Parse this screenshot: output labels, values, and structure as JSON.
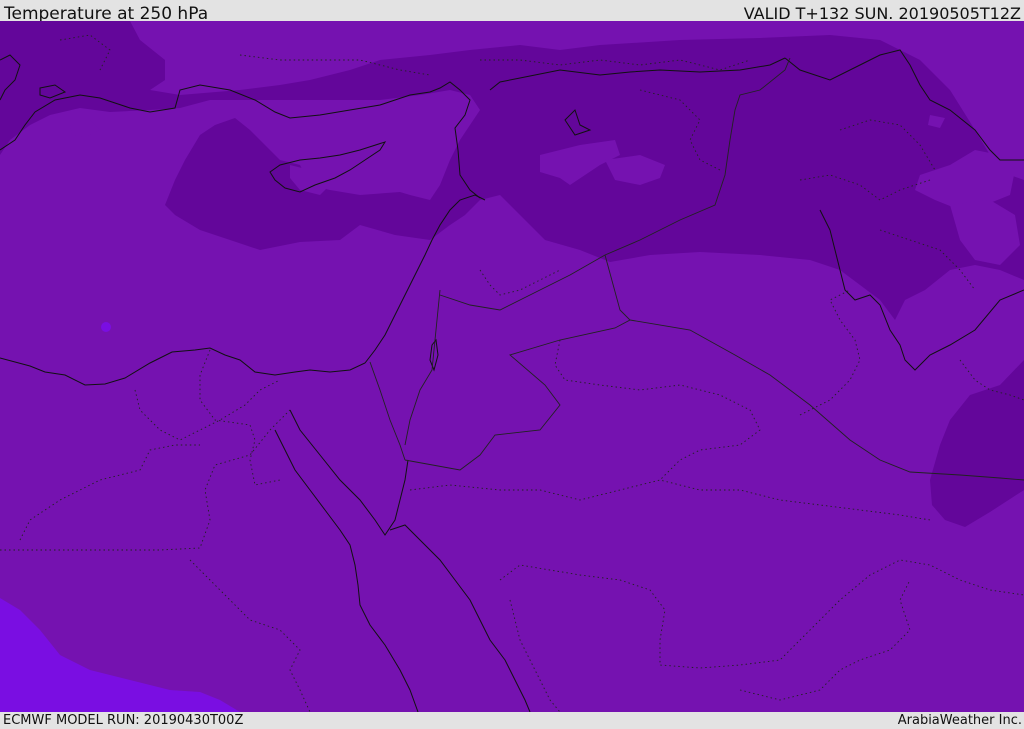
{
  "header": {
    "title": "Temperature at 250 hPa",
    "valid": "VALID T+132 SUN. 20190505T12Z"
  },
  "footer": {
    "model_run": "ECMWF MODEL RUN: 20190430T00Z",
    "credit": "ArabiaWeather Inc."
  },
  "map": {
    "field": "Temperature at 250 hPa",
    "colors": {
      "base": "#7512b0",
      "cold": "#63069a",
      "lighter": "#7d1fc0",
      "warm_corner": "#7a0ee2",
      "coast": "#111111",
      "border": "#222222"
    }
  }
}
